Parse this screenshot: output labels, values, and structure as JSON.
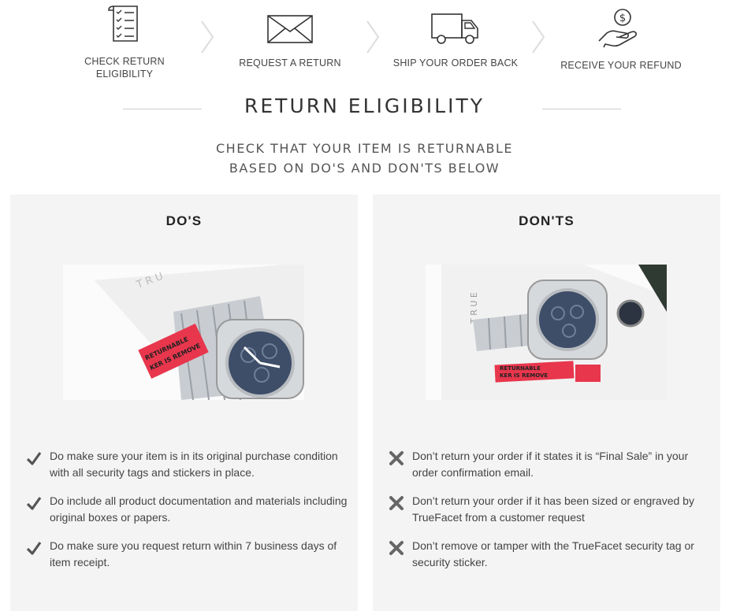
{
  "steps": [
    {
      "label_line1": "CHECK RETURN",
      "label_line2": "ELIGIBILITY",
      "icon": "checklist-icon"
    },
    {
      "label_line1": "REQUEST A RETURN",
      "label_line2": "",
      "icon": "envelope-icon"
    },
    {
      "label_line1": "SHIP YOUR ORDER BACK",
      "label_line2": "",
      "icon": "truck-icon"
    },
    {
      "label_line1": "RECEIVE YOUR REFUND",
      "label_line2": "",
      "icon": "refund-hand-icon"
    }
  ],
  "title": "RETURN ELIGIBILITY",
  "subtitle_line1": "CHECK THAT YOUR ITEM IS RETURNABLE",
  "subtitle_line2": "BASED ON DO'S AND DON'TS BELOW",
  "dos": {
    "heading": "DO'S",
    "image_label": "watch-with-tag-photo",
    "tag_text": "RETURNABLE / KER IS REMOVE",
    "items": [
      "Do make sure your item is in its original purchase condition with all security tags and stickers in place.",
      "Do include all product documentation and materials including original boxes or papers.",
      "Do make sure you request return within 7 business days of item receipt."
    ]
  },
  "donts": {
    "heading": "DON'TS",
    "image_label": "watch-tag-removed-photo",
    "tag_text": "RETURNABLE / KER IS REMOVE",
    "items": [
      "Don’t return your order if it states it is “Final Sale” in your order confirmation email.",
      "Don’t return your order if it has been sized or engraved by TrueFacet from a customer request",
      "Don’t remove or tamper with the TrueFacet security tag or security sticker."
    ]
  },
  "colors": {
    "check": "#555555",
    "cross": "#666666",
    "tag_red": "#e8364d",
    "panel_bg": "#f4f4f4"
  }
}
